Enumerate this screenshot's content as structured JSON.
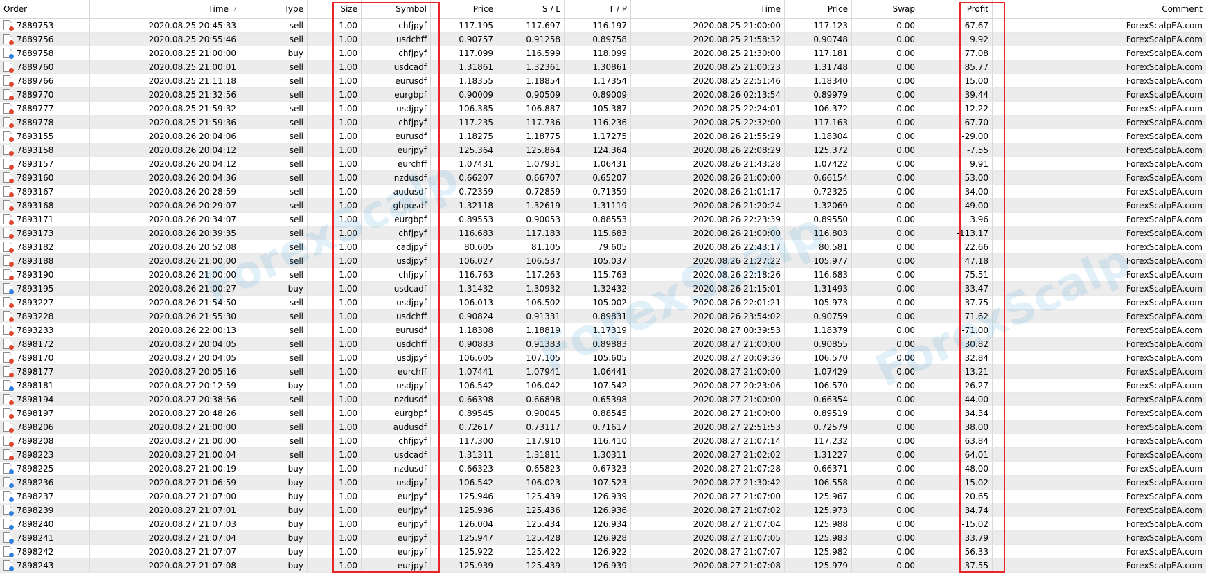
{
  "colors": {
    "sell_dot": "#e0452f",
    "buy_dot": "#2f7fe0",
    "highlight": "#e8262a",
    "alt_row": "#ececec"
  },
  "table": {
    "headers": [
      "Order",
      "Time",
      "Type",
      "Size",
      "Symbol",
      "Price",
      "S / L",
      "T / P",
      "Time",
      "Price",
      "Swap",
      "Profit",
      "Comment"
    ],
    "sort_indicator": "/",
    "rows": [
      [
        "7889753",
        "2020.08.25 20:45:33",
        "sell",
        "1.00",
        "chfjpyf",
        "117.195",
        "117.697",
        "116.197",
        "2020.08.25 21:00:00",
        "117.123",
        "0.00",
        "67.67",
        "ForexScalpEA.com"
      ],
      [
        "7889756",
        "2020.08.25 20:55:46",
        "sell",
        "1.00",
        "usdchff",
        "0.90757",
        "0.91258",
        "0.89758",
        "2020.08.25 21:58:32",
        "0.90748",
        "0.00",
        "9.92",
        "ForexScalpEA.com"
      ],
      [
        "7889758",
        "2020.08.25 21:00:00",
        "buy",
        "1.00",
        "chfjpyf",
        "117.099",
        "116.599",
        "118.099",
        "2020.08.25 21:30:00",
        "117.181",
        "0.00",
        "77.08",
        "ForexScalpEA.com"
      ],
      [
        "7889760",
        "2020.08.25 21:00:01",
        "sell",
        "1.00",
        "usdcadf",
        "1.31861",
        "1.32361",
        "1.30861",
        "2020.08.25 21:00:23",
        "1.31748",
        "0.00",
        "85.77",
        "ForexScalpEA.com"
      ],
      [
        "7889766",
        "2020.08.25 21:11:18",
        "sell",
        "1.00",
        "eurusdf",
        "1.18355",
        "1.18854",
        "1.17354",
        "2020.08.25 22:51:46",
        "1.18340",
        "0.00",
        "15.00",
        "ForexScalpEA.com"
      ],
      [
        "7889770",
        "2020.08.25 21:32:56",
        "sell",
        "1.00",
        "eurgbpf",
        "0.90009",
        "0.90509",
        "0.89009",
        "2020.08.26 02:13:54",
        "0.89979",
        "0.00",
        "39.44",
        "ForexScalpEA.com"
      ],
      [
        "7889777",
        "2020.08.25 21:59:32",
        "sell",
        "1.00",
        "usdjpyf",
        "106.385",
        "106.887",
        "105.387",
        "2020.08.25 22:24:01",
        "106.372",
        "0.00",
        "12.22",
        "ForexScalpEA.com"
      ],
      [
        "7889778",
        "2020.08.25 21:59:36",
        "sell",
        "1.00",
        "chfjpyf",
        "117.235",
        "117.736",
        "116.236",
        "2020.08.25 22:32:00",
        "117.163",
        "0.00",
        "67.70",
        "ForexScalpEA.com"
      ],
      [
        "7893155",
        "2020.08.26 20:04:06",
        "sell",
        "1.00",
        "eurusdf",
        "1.18275",
        "1.18775",
        "1.17275",
        "2020.08.26 21:55:29",
        "1.18304",
        "0.00",
        "-29.00",
        "ForexScalpEA.com"
      ],
      [
        "7893158",
        "2020.08.26 20:04:12",
        "sell",
        "1.00",
        "eurjpyf",
        "125.364",
        "125.864",
        "124.364",
        "2020.08.26 22:08:29",
        "125.372",
        "0.00",
        "-7.55",
        "ForexScalpEA.com"
      ],
      [
        "7893157",
        "2020.08.26 20:04:12",
        "sell",
        "1.00",
        "eurchff",
        "1.07431",
        "1.07931",
        "1.06431",
        "2020.08.26 21:43:28",
        "1.07422",
        "0.00",
        "9.91",
        "ForexScalpEA.com"
      ],
      [
        "7893160",
        "2020.08.26 20:04:36",
        "sell",
        "1.00",
        "nzdusdf",
        "0.66207",
        "0.66707",
        "0.65207",
        "2020.08.26 21:00:00",
        "0.66154",
        "0.00",
        "53.00",
        "ForexScalpEA.com"
      ],
      [
        "7893167",
        "2020.08.26 20:28:59",
        "sell",
        "1.00",
        "audusdf",
        "0.72359",
        "0.72859",
        "0.71359",
        "2020.08.26 21:01:17",
        "0.72325",
        "0.00",
        "34.00",
        "ForexScalpEA.com"
      ],
      [
        "7893168",
        "2020.08.26 20:29:07",
        "sell",
        "1.00",
        "gbpusdf",
        "1.32118",
        "1.32619",
        "1.31119",
        "2020.08.26 21:20:24",
        "1.32069",
        "0.00",
        "49.00",
        "ForexScalpEA.com"
      ],
      [
        "7893171",
        "2020.08.26 20:34:07",
        "sell",
        "1.00",
        "eurgbpf",
        "0.89553",
        "0.90053",
        "0.88553",
        "2020.08.26 22:23:39",
        "0.89550",
        "0.00",
        "3.96",
        "ForexScalpEA.com"
      ],
      [
        "7893173",
        "2020.08.26 20:39:35",
        "sell",
        "1.00",
        "chfjpyf",
        "116.683",
        "117.183",
        "115.683",
        "2020.08.26 21:00:00",
        "116.803",
        "0.00",
        "-113.17",
        "ForexScalpEA.com"
      ],
      [
        "7893182",
        "2020.08.26 20:52:08",
        "sell",
        "1.00",
        "cadjpyf",
        "80.605",
        "81.105",
        "79.605",
        "2020.08.26 22:43:17",
        "80.581",
        "0.00",
        "22.66",
        "ForexScalpEA.com"
      ],
      [
        "7893188",
        "2020.08.26 21:00:00",
        "sell",
        "1.00",
        "usdjpyf",
        "106.027",
        "106.537",
        "105.037",
        "2020.08.26 21:27:22",
        "105.977",
        "0.00",
        "47.18",
        "ForexScalpEA.com"
      ],
      [
        "7893190",
        "2020.08.26 21:00:00",
        "sell",
        "1.00",
        "chfjpyf",
        "116.763",
        "117.263",
        "115.763",
        "2020.08.26 22:18:26",
        "116.683",
        "0.00",
        "75.51",
        "ForexScalpEA.com"
      ],
      [
        "7893195",
        "2020.08.26 21:00:27",
        "buy",
        "1.00",
        "usdcadf",
        "1.31432",
        "1.30932",
        "1.32432",
        "2020.08.26 21:15:01",
        "1.31493",
        "0.00",
        "33.47",
        "ForexScalpEA.com"
      ],
      [
        "7893227",
        "2020.08.26 21:54:50",
        "sell",
        "1.00",
        "usdjpyf",
        "106.013",
        "106.502",
        "105.002",
        "2020.08.26 22:01:21",
        "105.973",
        "0.00",
        "37.75",
        "ForexScalpEA.com"
      ],
      [
        "7893228",
        "2020.08.26 21:55:30",
        "sell",
        "1.00",
        "usdchff",
        "0.90824",
        "0.91331",
        "0.89831",
        "2020.08.26 23:54:02",
        "0.90759",
        "0.00",
        "71.62",
        "ForexScalpEA.com"
      ],
      [
        "7893233",
        "2020.08.26 22:00:13",
        "sell",
        "1.00",
        "eurusdf",
        "1.18308",
        "1.18819",
        "1.17319",
        "2020.08.27 00:39:53",
        "1.18379",
        "0.00",
        "-71.00",
        "ForexScalpEA.com"
      ],
      [
        "7898172",
        "2020.08.27 20:04:05",
        "sell",
        "1.00",
        "usdchff",
        "0.90883",
        "0.91383",
        "0.89883",
        "2020.08.27 21:00:00",
        "0.90855",
        "0.00",
        "30.82",
        "ForexScalpEA.com"
      ],
      [
        "7898170",
        "2020.08.27 20:04:05",
        "sell",
        "1.00",
        "usdjpyf",
        "106.605",
        "107.105",
        "105.605",
        "2020.08.27 20:09:36",
        "106.570",
        "0.00",
        "32.84",
        "ForexScalpEA.com"
      ],
      [
        "7898177",
        "2020.08.27 20:05:16",
        "sell",
        "1.00",
        "eurchff",
        "1.07441",
        "1.07941",
        "1.06441",
        "2020.08.27 21:00:00",
        "1.07429",
        "0.00",
        "13.21",
        "ForexScalpEA.com"
      ],
      [
        "7898181",
        "2020.08.27 20:12:59",
        "buy",
        "1.00",
        "usdjpyf",
        "106.542",
        "106.042",
        "107.542",
        "2020.08.27 20:23:06",
        "106.570",
        "0.00",
        "26.27",
        "ForexScalpEA.com"
      ],
      [
        "7898194",
        "2020.08.27 20:38:56",
        "sell",
        "1.00",
        "nzdusdf",
        "0.66398",
        "0.66898",
        "0.65398",
        "2020.08.27 21:00:00",
        "0.66354",
        "0.00",
        "44.00",
        "ForexScalpEA.com"
      ],
      [
        "7898197",
        "2020.08.27 20:48:26",
        "sell",
        "1.00",
        "eurgbpf",
        "0.89545",
        "0.90045",
        "0.88545",
        "2020.08.27 21:00:00",
        "0.89519",
        "0.00",
        "34.34",
        "ForexScalpEA.com"
      ],
      [
        "7898206",
        "2020.08.27 21:00:00",
        "sell",
        "1.00",
        "audusdf",
        "0.72617",
        "0.73117",
        "0.71617",
        "2020.08.27 22:51:53",
        "0.72579",
        "0.00",
        "38.00",
        "ForexScalpEA.com"
      ],
      [
        "7898208",
        "2020.08.27 21:00:00",
        "sell",
        "1.00",
        "chfjpyf",
        "117.300",
        "117.910",
        "116.410",
        "2020.08.27 21:07:14",
        "117.232",
        "0.00",
        "63.84",
        "ForexScalpEA.com"
      ],
      [
        "7898223",
        "2020.08.27 21:00:04",
        "sell",
        "1.00",
        "usdcadf",
        "1.31311",
        "1.31811",
        "1.30311",
        "2020.08.27 21:02:02",
        "1.31227",
        "0.00",
        "64.01",
        "ForexScalpEA.com"
      ],
      [
        "7898225",
        "2020.08.27 21:00:19",
        "buy",
        "1.00",
        "nzdusdf",
        "0.66323",
        "0.65823",
        "0.67323",
        "2020.08.27 21:07:28",
        "0.66371",
        "0.00",
        "48.00",
        "ForexScalpEA.com"
      ],
      [
        "7898236",
        "2020.08.27 21:06:59",
        "buy",
        "1.00",
        "usdjpyf",
        "106.542",
        "106.023",
        "107.523",
        "2020.08.27 21:30:42",
        "106.558",
        "0.00",
        "15.02",
        "ForexScalpEA.com"
      ],
      [
        "7898237",
        "2020.08.27 21:07:00",
        "buy",
        "1.00",
        "eurjpyf",
        "125.946",
        "125.439",
        "126.939",
        "2020.08.27 21:07:00",
        "125.967",
        "0.00",
        "20.65",
        "ForexScalpEA.com"
      ],
      [
        "7898239",
        "2020.08.27 21:07:01",
        "buy",
        "1.00",
        "eurjpyf",
        "125.936",
        "125.436",
        "126.936",
        "2020.08.27 21:07:02",
        "125.973",
        "0.00",
        "34.74",
        "ForexScalpEA.com"
      ],
      [
        "7898240",
        "2020.08.27 21:07:03",
        "buy",
        "1.00",
        "eurjpyf",
        "126.004",
        "125.434",
        "126.934",
        "2020.08.27 21:07:04",
        "125.988",
        "0.00",
        "-15.02",
        "ForexScalpEA.com"
      ],
      [
        "7898241",
        "2020.08.27 21:07:04",
        "buy",
        "1.00",
        "eurjpyf",
        "125.947",
        "125.428",
        "126.928",
        "2020.08.27 21:07:05",
        "125.983",
        "0.00",
        "33.79",
        "ForexScalpEA.com"
      ],
      [
        "7898242",
        "2020.08.27 21:07:07",
        "buy",
        "1.00",
        "eurjpyf",
        "125.922",
        "125.422",
        "126.922",
        "2020.08.27 21:07:07",
        "125.982",
        "0.00",
        "56.33",
        "ForexScalpEA.com"
      ],
      [
        "7898243",
        "2020.08.27 21:07:08",
        "buy",
        "1.00",
        "eurjpyf",
        "125.939",
        "125.439",
        "126.939",
        "2020.08.27 21:07:08",
        "125.979",
        "0.00",
        "37.55",
        "ForexScalpEA.com"
      ]
    ]
  }
}
